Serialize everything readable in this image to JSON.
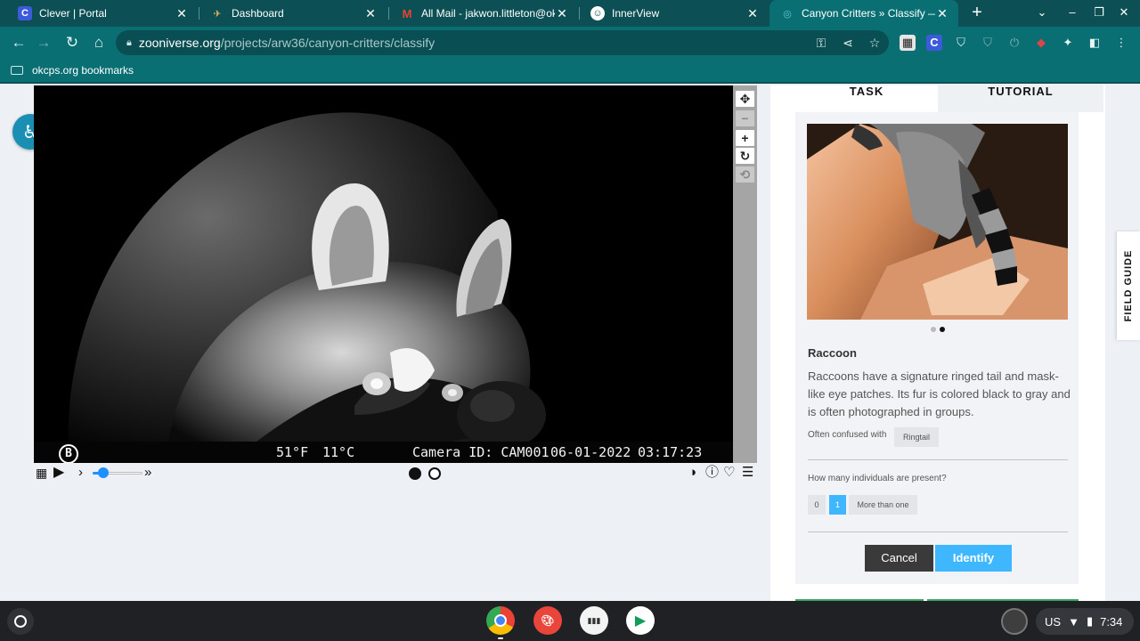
{
  "tabs": [
    {
      "title": "Clever | Portal",
      "favicon": "C"
    },
    {
      "title": "Dashboard",
      "favicon": ""
    },
    {
      "title": "All Mail - jakwon.littleton@okc",
      "favicon": "M"
    },
    {
      "title": "InnerView",
      "favicon": ""
    },
    {
      "title": "Canyon Critters » Classify — Z",
      "favicon": ""
    }
  ],
  "address_bar": {
    "host": "zooniverse.org",
    "path": "/projects/arw36/canyon-critters/classify"
  },
  "bookmarks": {
    "folder": "okcps.org bookmarks"
  },
  "viewer": {
    "camera_overlay": {
      "brand": "B",
      "temp_f": "51°F",
      "temp_c": "11°C",
      "camera_id": "Camera ID: CAM001",
      "date": "06-01-2022",
      "time": "03:17:23"
    },
    "tools": [
      "move-icon",
      "zoom-out-icon",
      "zoom-in-icon",
      "rotate-icon",
      "reset-icon"
    ],
    "frame_count": 2,
    "current_frame": 1
  },
  "task_panel": {
    "tab_task": "TASK",
    "tab_tutorial": "TUTORIAL",
    "species_name": "Raccoon",
    "species_description": "Raccoons have a signature ringed tail and mask-like eye patches. Its fur is colored black to gray and is often photographed in groups.",
    "confused_label": "Often confused with",
    "confused_with": "Ringtail",
    "question": "How many individuals are present?",
    "answers": [
      "0",
      "1",
      "More than one"
    ],
    "selected_answer": "1",
    "cancel_label": "Cancel",
    "identify_label": "Identify",
    "photo_count": 2,
    "photo_current": 2
  },
  "field_guide_label": "FIELD GUIDE",
  "tray": {
    "locale": "US",
    "time": "7:34"
  },
  "colors": {
    "frame": "#0c4f54",
    "toolbar": "#0a6f73",
    "accent_blue": "#3fb7ff"
  }
}
